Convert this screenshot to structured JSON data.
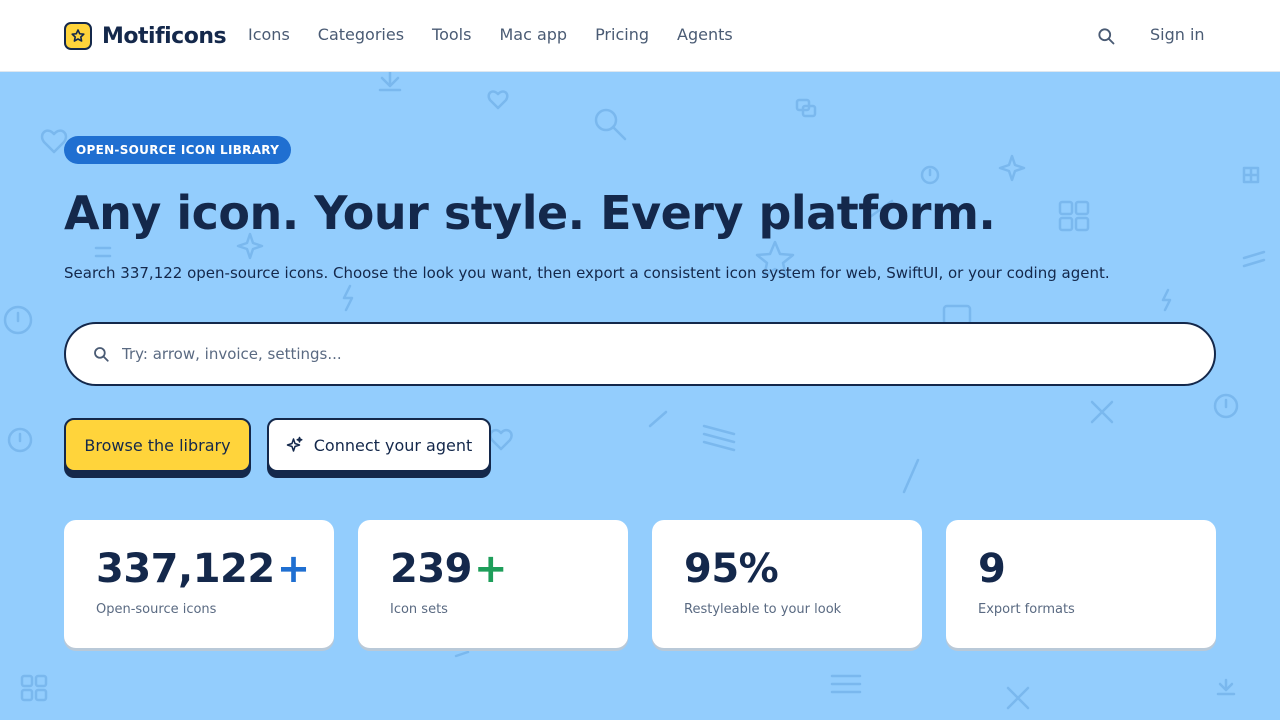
{
  "header": {
    "brand": "Motificons",
    "nav": [
      "Icons",
      "Categories",
      "Tools",
      "Mac app",
      "Pricing",
      "Agents"
    ],
    "sign_in": "Sign in"
  },
  "hero": {
    "badge": "OPEN-SOURCE ICON LIBRARY",
    "headline": "Any icon. Your style. Every platform.",
    "subline": "Search 337,122 open-source icons. Choose the look you want, then export a consistent icon system for web, SwiftUI, or your coding agent.",
    "search_placeholder": "Try: arrow, invoice, settings...",
    "primary_button": "Browse the library",
    "secondary_button": "Connect your agent"
  },
  "stats": [
    {
      "value": "337,122",
      "suffix": "+",
      "suffix_color": "#1f6fd1",
      "label": "Open-source icons"
    },
    {
      "value": "239",
      "suffix": "+",
      "suffix_color": "#1e9e5a",
      "label": "Icon sets"
    },
    {
      "value": "95%",
      "suffix": "",
      "suffix_color": "",
      "label": "Restyleable to your look"
    },
    {
      "value": "9",
      "suffix": "",
      "suffix_color": "",
      "label": "Export formats"
    }
  ],
  "colors": {
    "page_background": "#93cdfd",
    "brand_yellow": "#ffd43b",
    "ink": "#14284b",
    "badge_blue": "#1f6fd1"
  },
  "icons": [
    "star-icon",
    "search-icon",
    "sparkle-icon"
  ]
}
